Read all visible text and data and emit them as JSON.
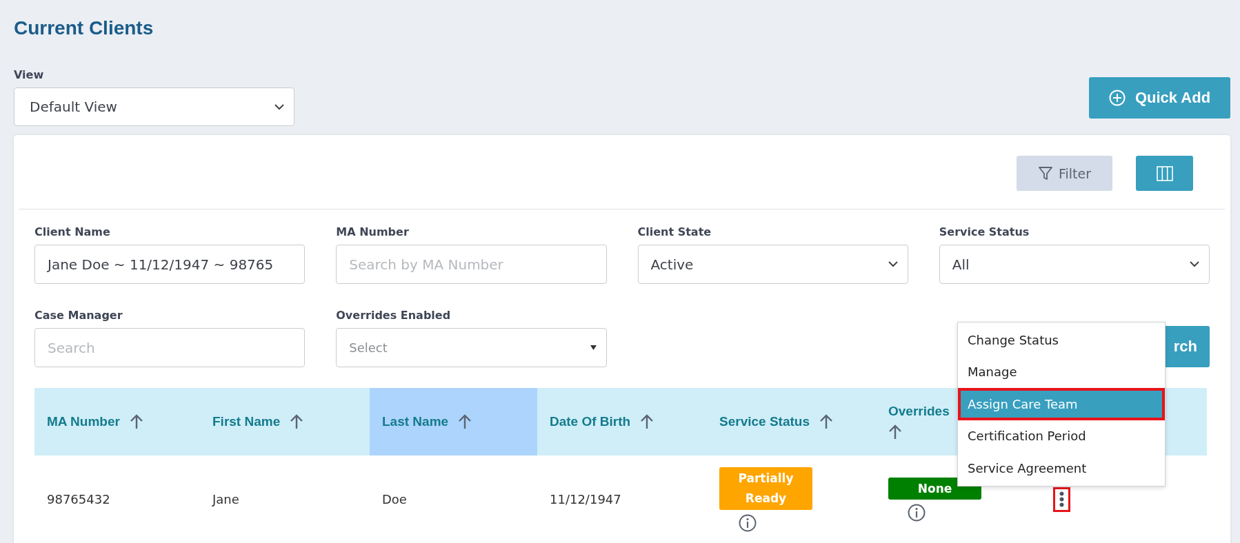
{
  "page": {
    "title": "Current Clients"
  },
  "view": {
    "label": "View",
    "value": "Default View"
  },
  "quick_add": {
    "label": "Quick Add"
  },
  "toolbar": {
    "filter_label": "Filter"
  },
  "filters": [
    {
      "label": "Client Name",
      "kind": "text",
      "value": "Jane Doe ~ 11/12/1947 ~ 98765"
    },
    {
      "label": "MA Number",
      "kind": "text",
      "placeholder": "Search by MA Number"
    },
    {
      "label": "Client State",
      "kind": "select",
      "value": "Active"
    },
    {
      "label": "Service Status",
      "kind": "select",
      "value": "All"
    },
    {
      "label": "Case Manager",
      "kind": "text",
      "placeholder": "Search"
    },
    {
      "label": "Overrides Enabled",
      "kind": "dropdown",
      "placeholder": "Select"
    }
  ],
  "search_button": {
    "label": "rch"
  },
  "table": {
    "columns": [
      {
        "label": "MA Number",
        "selected": false,
        "kind": "inline"
      },
      {
        "label": "First Name",
        "selected": false,
        "kind": "inline"
      },
      {
        "label": "Last Name",
        "selected": true,
        "kind": "inline"
      },
      {
        "label": "Date Of Birth",
        "selected": false,
        "kind": "inline"
      },
      {
        "label": "Service Status",
        "selected": false,
        "kind": "inline"
      },
      {
        "label": "Overrides",
        "selected": false,
        "kind": "stacked"
      },
      {
        "kind": "blank",
        "selected": false
      }
    ],
    "rows": [
      {
        "cells": [
          {
            "kind": "text",
            "text": "98765432"
          },
          {
            "kind": "text",
            "text": "Jane"
          },
          {
            "kind": "text",
            "text": "Doe"
          },
          {
            "kind": "text",
            "text": "11/12/1947"
          },
          {
            "kind": "warning",
            "text": "Partially Ready"
          },
          {
            "kind": "success",
            "text": "None"
          },
          {
            "kind": "actions"
          }
        ]
      }
    ]
  },
  "menu": {
    "items": [
      {
        "label": "Change Status",
        "selected": false
      },
      {
        "label": "Manage",
        "selected": false
      },
      {
        "label": "Assign Care Team",
        "selected": true
      },
      {
        "label": "Certification Period",
        "selected": false
      },
      {
        "label": "Service Agreement",
        "selected": false
      }
    ]
  }
}
